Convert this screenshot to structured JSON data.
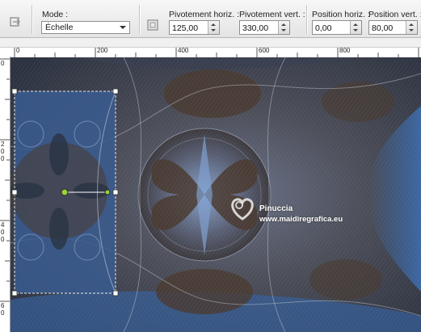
{
  "toolbar": {
    "mode_label": "Mode :",
    "mode_value": "Échelle",
    "pivot_h_label": "Pivotement horiz. :",
    "pivot_h_value": "125,00",
    "pivot_v_label": "Pivotement vert. :",
    "pivot_v_value": "330,00",
    "pos_h_label": "Position horiz. :",
    "pos_h_value": "0,00",
    "pos_v_label": "Position vert. :",
    "pos_v_value": "80,00"
  },
  "ruler_top": [
    "0",
    "200",
    "400",
    "600",
    "800"
  ],
  "ruler_left": [
    "0",
    "2",
    "0",
    "0",
    "4",
    "0",
    "0",
    "6",
    "0"
  ],
  "watermark": {
    "line1": "Pinuccia",
    "line2": "www.maidiregrafica.eu"
  },
  "colors": {
    "canvas_blue": "#3c6aa8",
    "canvas_brown": "#4a3a30",
    "handle_green": "#9bd13a"
  }
}
